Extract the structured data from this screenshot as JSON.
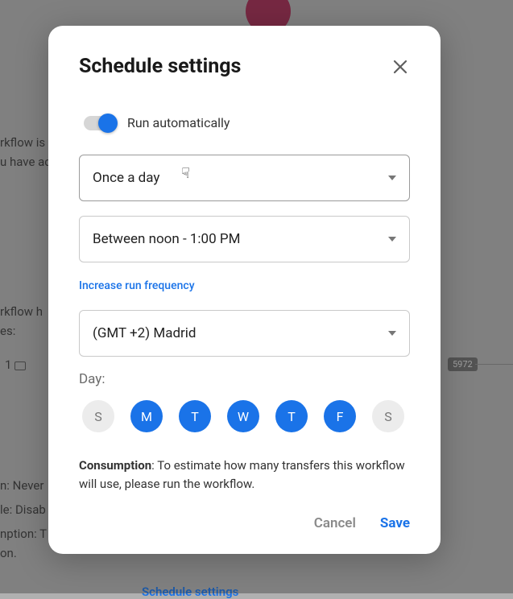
{
  "modal": {
    "title": "Schedule settings",
    "toggle_label": "Run automatically",
    "frequency_select": "Once a day",
    "time_select": "Between noon - 1:00 PM",
    "increase_link": "Increase run frequency",
    "tz_select": "(GMT +2) Madrid",
    "day_label": "Day:",
    "days": [
      {
        "letter": "S",
        "on": false
      },
      {
        "letter": "M",
        "on": true
      },
      {
        "letter": "T",
        "on": true
      },
      {
        "letter": "W",
        "on": true
      },
      {
        "letter": "T",
        "on": true
      },
      {
        "letter": "F",
        "on": true
      },
      {
        "letter": "S",
        "on": false
      }
    ],
    "consumption_label": "Consumption",
    "consumption_text": ": To estimate how many transfers this workflow will use, please run the workflow.",
    "cancel": "Cancel",
    "save": "Save"
  },
  "bg": {
    "line1": "rkflow is",
    "line2": "u have ac",
    "line3": "rkflow h",
    "line4": "es:",
    "line5a": "1",
    "line6": "n:  Never",
    "line7": "le:  Disab",
    "line8": "nption:  T",
    "line9": "on.",
    "link": "Schedule settings",
    "chip": "5972"
  }
}
